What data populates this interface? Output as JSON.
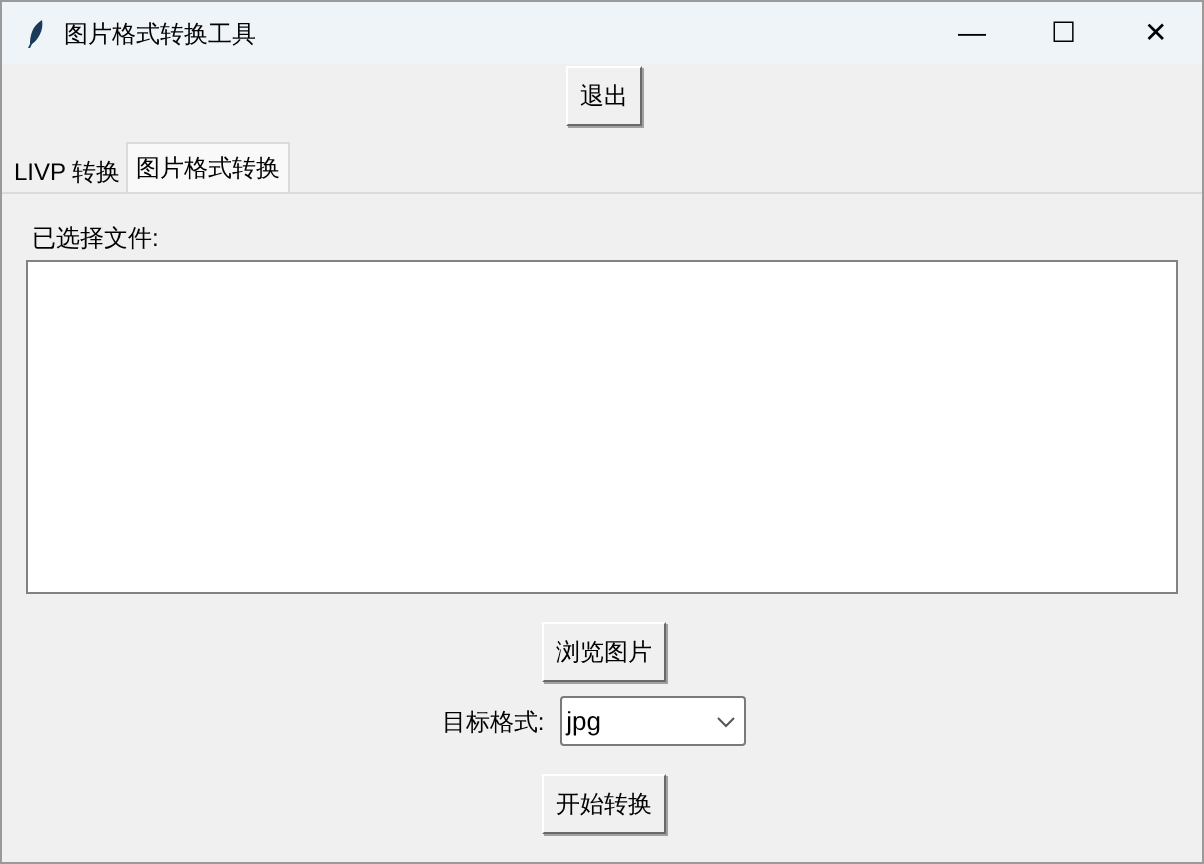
{
  "window": {
    "title": "图片格式转换工具",
    "controls": [
      "—",
      "☐",
      "✕"
    ]
  },
  "exit_button": "退出",
  "tabs": [
    {
      "label": "LIVP 转换",
      "selected": false
    },
    {
      "label": "图片格式转换",
      "selected": true
    }
  ],
  "file_list": {
    "label": "已选择文件:"
  },
  "browse_button": "浏览图片",
  "target_format": {
    "label": "目标格式:",
    "value": "jpg"
  },
  "start_button": "开始转换"
}
